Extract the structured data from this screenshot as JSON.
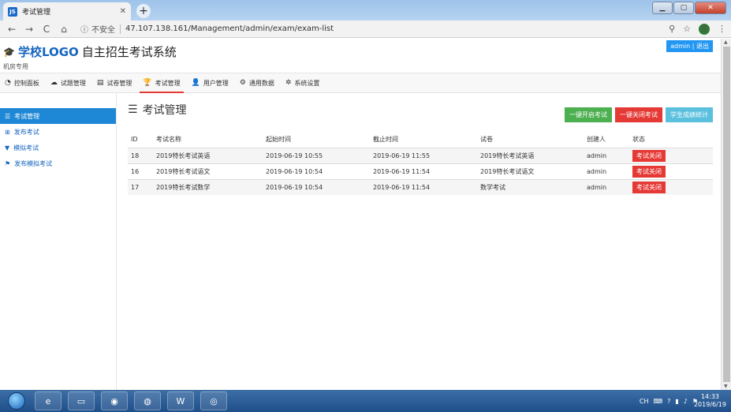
{
  "browser": {
    "tab_title": "考试管理",
    "tab_favicon": "JS",
    "url": "47.107.138.161/Management/admin/exam/exam-list",
    "insecure_label": "不安全",
    "profile_initial": "B"
  },
  "header": {
    "logo_mark": "学校LOGO",
    "title": "自主招生考试系统",
    "subtitle": "机房专用",
    "user": "admin | 退出"
  },
  "nav": {
    "items": [
      {
        "label": "控制面板",
        "icon": "dashboard-icon"
      },
      {
        "label": "试题管理",
        "icon": "cloud-icon"
      },
      {
        "label": "试卷管理",
        "icon": "document-icon"
      },
      {
        "label": "考试管理",
        "icon": "trophy-icon"
      },
      {
        "label": "用户管理",
        "icon": "user-icon"
      },
      {
        "label": "通用数据",
        "icon": "data-icon"
      },
      {
        "label": "系统设置",
        "icon": "gear-icon"
      }
    ]
  },
  "sidebar": {
    "items": [
      {
        "label": "考试管理",
        "icon": "list-icon"
      },
      {
        "label": "发布考试",
        "icon": "plus-icon"
      },
      {
        "label": "模拟考试",
        "icon": "filter-icon"
      },
      {
        "label": "发布模拟考试",
        "icon": "flag-icon"
      }
    ]
  },
  "main": {
    "title": "考试管理",
    "buttons": {
      "open_all": "一键开启考试",
      "close_all": "一键关闭考试",
      "stats": "学生成绩统计"
    },
    "table": {
      "headers": [
        "ID",
        "考试名称",
        "起始时间",
        "截止时间",
        "试卷",
        "创建人",
        "状态"
      ],
      "rows": [
        [
          "18",
          "2019特长考试英语",
          "2019-06-19 10:55",
          "2019-06-19 11:55",
          "2019特长考试英语",
          "admin",
          "考试关闭"
        ],
        [
          "16",
          "2019特长考试语文",
          "2019-06-19 10:54",
          "2019-06-19 11:54",
          "2019特长考试语文",
          "admin",
          "考试关闭"
        ],
        [
          "17",
          "2019特长考试数学",
          "2019-06-19 10:54",
          "2019-06-19 11:54",
          "数学考试",
          "admin",
          "考试关闭"
        ]
      ]
    }
  },
  "taskbar": {
    "lang": "CH",
    "time": "14:33",
    "date": "2019/6/19"
  }
}
